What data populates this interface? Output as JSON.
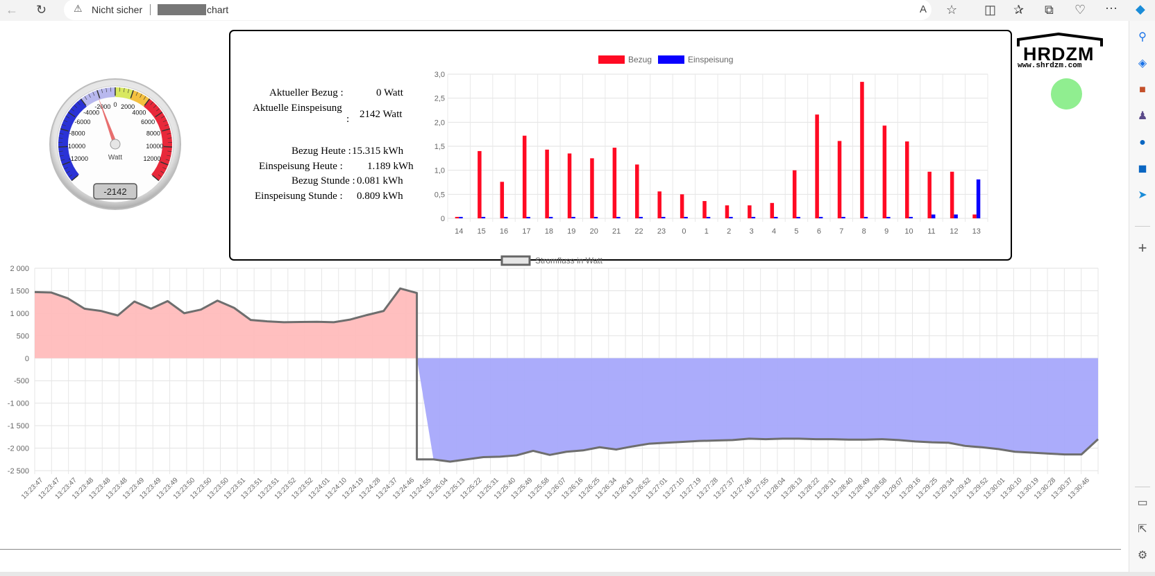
{
  "browser": {
    "not_secure": "Nicht sicher",
    "url_path": "chart"
  },
  "gauge": {
    "unit": "Watt",
    "value_display": "-2142",
    "value": -2142,
    "min": -14000,
    "max": 14000,
    "scale_labels": [
      "-12000",
      "-10000",
      "-8000",
      "-6000",
      "-4000",
      "-2000",
      "0",
      "2000",
      "4000",
      "6000",
      "8000",
      "10000",
      "12000"
    ]
  },
  "stats": {
    "current_import_label": "Aktueller Bezug :",
    "current_import_value": "0 Watt",
    "current_export_label": "Aktuelle Einspeisung",
    "current_export_colon": ":",
    "current_export_value": "2142 Watt",
    "import_today_label": "Bezug Heute :",
    "import_today_value": "15.315 kWh",
    "export_today_label": "Einspeisung Heute :",
    "export_today_value": "1.189 kWh",
    "import_hour_label": "Bezug Stunde :",
    "import_hour_value": "0.081 kWh",
    "export_hour_label": "Einspeisung Stunde :",
    "export_hour_value": "0.809 kWh"
  },
  "logo": {
    "text": "HRDZM",
    "url": "www.shrdzm.com"
  },
  "colors": {
    "import": "#ff0a23",
    "export": "#0a00ff",
    "positive_fill": "#ffbcbc",
    "negative_fill": "#a6a8fb",
    "line": "#6e6e6e",
    "status_ok": "#90ee90"
  },
  "chart_data": [
    {
      "type": "bar",
      "categories": [
        "14",
        "15",
        "16",
        "17",
        "18",
        "19",
        "20",
        "21",
        "22",
        "23",
        "0",
        "1",
        "2",
        "3",
        "4",
        "5",
        "6",
        "7",
        "8",
        "9",
        "10",
        "11",
        "12",
        "13"
      ],
      "series": [
        {
          "name": "Bezug",
          "color": "#ff0a23",
          "values": [
            0.03,
            1.4,
            0.76,
            1.72,
            1.43,
            1.35,
            1.25,
            1.47,
            1.12,
            0.56,
            0.5,
            0.36,
            0.27,
            0.27,
            0.32,
            1.0,
            2.16,
            1.61,
            2.84,
            1.93,
            1.6,
            0.97,
            0.97,
            0.08
          ]
        },
        {
          "name": "Einspeisung",
          "color": "#0a00ff",
          "values": [
            0.03,
            0.03,
            0.03,
            0.03,
            0.03,
            0.03,
            0.03,
            0.03,
            0.03,
            0.03,
            0.03,
            0.03,
            0.03,
            0.03,
            0.03,
            0.03,
            0.03,
            0.03,
            0.03,
            0.03,
            0.03,
            0.08,
            0.08,
            0.81
          ]
        }
      ],
      "ylim": [
        0,
        3.0
      ],
      "yticks": [
        "0",
        "0,5",
        "1,0",
        "1,5",
        "2,0",
        "2,5",
        "3,0"
      ],
      "legend": "top",
      "grid": true
    },
    {
      "type": "area",
      "series": [
        {
          "name": "Stromfluss in Watt"
        }
      ],
      "ylim": [
        -2500,
        2000
      ],
      "yticks": [
        "2 000",
        "1 500",
        "1 000",
        "500",
        "0",
        "-500",
        "-1 000",
        "-1 500",
        "-2 000",
        "-2 500"
      ],
      "x": [
        "13:23:47",
        "13:23:47",
        "13:23:47",
        "13:23:48",
        "13:23:48",
        "13:23:48",
        "13:23:49",
        "13:23:49",
        "13:23:49",
        "13:23:50",
        "13:23:50",
        "13:23:50",
        "13:23:51",
        "13:23:51",
        "13:23:51",
        "13:23:52",
        "13:23:52",
        "13:24:01",
        "13:24:10",
        "13:24:19",
        "13:24:28",
        "13:24:37",
        "13:24:46",
        "13:24:55",
        "13:25:04",
        "13:25:13",
        "13:25:22",
        "13:25:31",
        "13:25:40",
        "13:25:49",
        "13:25:58",
        "13:26:07",
        "13:26:16",
        "13:26:25",
        "13:26:34",
        "13:26:43",
        "13:26:52",
        "13:27:01",
        "13:27:10",
        "13:27:19",
        "13:27:28",
        "13:27:37",
        "13:27:46",
        "13:27:55",
        "13:28:04",
        "13:28:13",
        "13:28:22",
        "13:28:31",
        "13:28:40",
        "13:28:49",
        "13:28:58",
        "13:29:07",
        "13:29:16",
        "13:29:25",
        "13:29:34",
        "13:29:43",
        "13:29:52",
        "13:30:01",
        "13:30:10",
        "13:30:19",
        "13:30:28",
        "13:30:37",
        "13:30:46"
      ],
      "values": [
        1470,
        1460,
        1330,
        1100,
        1050,
        950,
        1260,
        1100,
        1270,
        1000,
        1080,
        1280,
        1120,
        850,
        820,
        800,
        805,
        810,
        800,
        860,
        960,
        1050,
        1550,
        1450,
        -2250,
        -2300,
        -2250,
        -2200,
        -2190,
        -2160,
        -2060,
        -2150,
        -2080,
        -2050,
        -1980,
        -2030,
        -1960,
        -1900,
        -1880,
        -1860,
        -1840,
        -1830,
        -1820,
        -1790,
        -1800,
        -1790,
        -1790,
        -1800,
        -1800,
        -1810,
        -1810,
        -1800,
        -1820,
        -1850,
        -1870,
        -1880,
        -1950,
        -1980,
        -2020,
        -2080,
        -2100,
        -2120,
        -2140,
        -2140,
        -1800
      ],
      "legend": "top",
      "grid": true
    }
  ]
}
